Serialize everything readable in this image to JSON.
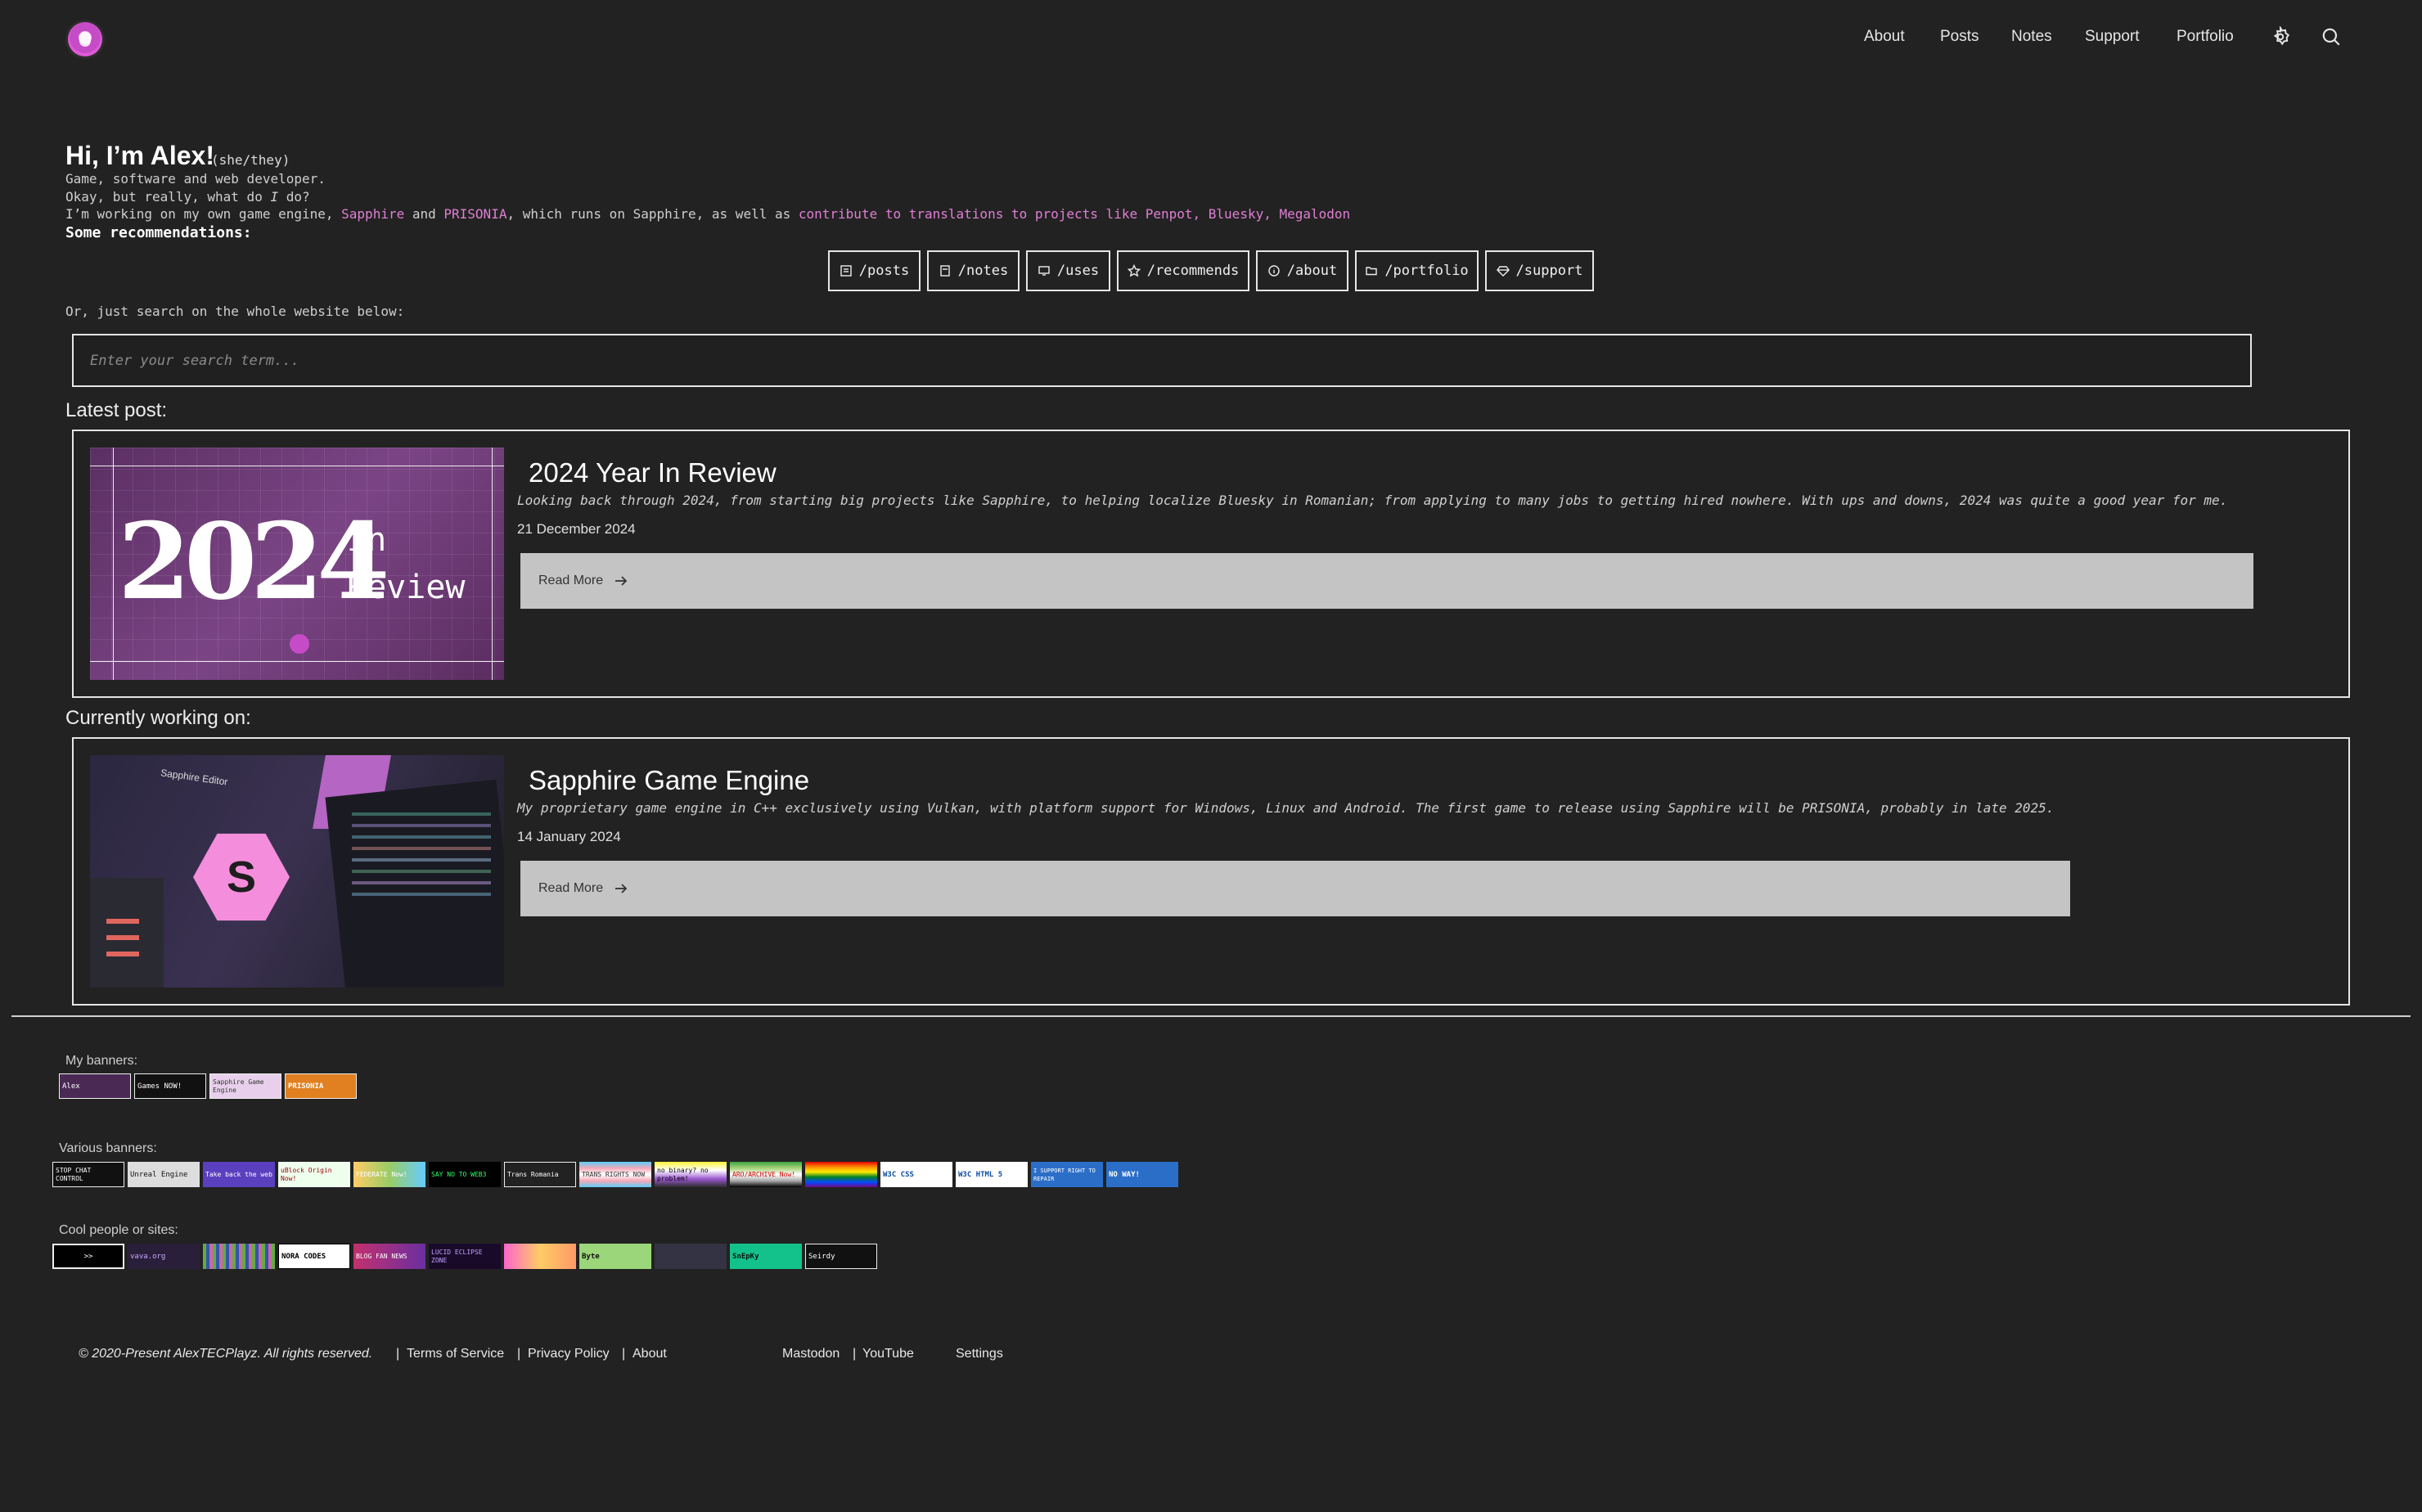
{
  "header": {
    "nav": [
      "About",
      "Posts",
      "Notes",
      "Support",
      "Portfolio"
    ]
  },
  "intro": {
    "greeting": "Hi, I’m Alex!",
    "pronouns": "(she/they)",
    "line1": "Game, software and web developer.",
    "line2a": "Okay, but really, what do ",
    "line2b": "I",
    "line2c": " do?",
    "line3_prefix": "I’m working on my own game engine, ",
    "link_sapphire": "Sapphire",
    "and": " and ",
    "link_prisonia": "PRISONIA",
    "line3_mid": ", which runs on Sapphire, as well as ",
    "link_translations": "contribute to translations to projects like Penpot, Bluesky, Megalodon",
    "recommendations_label": "Some recommendations:"
  },
  "chips": [
    "/posts",
    "/notes",
    "/uses",
    "/recommends",
    "/about",
    "/portfolio",
    "/support"
  ],
  "search": {
    "label": "Or, just search on the whole website below:",
    "placeholder": "Enter your search term..."
  },
  "latest": {
    "heading": "Latest post:",
    "title": "2024 Year In Review",
    "description": "Looking back through 2024, from starting big projects like Sapphire, to helping localize Bluesky in Romanian; from applying to many jobs to getting hired nowhere. With ups and downs, 2024 was quite a good year for me.",
    "date": "21 December 2024",
    "read_more": "Read More",
    "image_text_year": "2024",
    "image_text_in": "in",
    "image_text_review": "Review"
  },
  "working": {
    "heading": "Currently working on:",
    "title": "Sapphire Game Engine",
    "description": "My proprietary game engine in C++ exclusively using Vulkan, with platform support for Windows, Linux and Android. The first game to release using Sapphire will be PRISONIA, probably in late 2025.",
    "date": "14 January 2024",
    "read_more": "Read More",
    "image_caption": "Sapphire Editor",
    "image_letter": "S"
  },
  "banners": {
    "my_label": "My banners:",
    "my": [
      "Alex",
      "Games NOW!",
      "Sapphire Game Engine",
      "PRISONIA"
    ],
    "various_label": "Various banners:",
    "various": [
      "STOP CHAT CONTROL",
      "Unreal Engine",
      "Take back the web",
      "uBlock Origin Now!",
      "FEDERATE Now!",
      "SAY NO TO WEB3",
      "Trans Romania",
      "TRANS RIGHTS NOW",
      "no binary? no problem!",
      "ARO/ARCHIVE Now!",
      "",
      "W3C CSS",
      "W3C HTML 5",
      "I SUPPORT RIGHT TO REPAIR",
      "NO WAY!"
    ],
    "cool_label": "Cool people or sites:",
    "cool": [
      ">>",
      "vava.org",
      "",
      "NORA CODES",
      "BLOG FAN NEWS",
      "LUCID ECLIPSE ZONE",
      "",
      "Byte",
      "",
      "SnEpKy",
      "Seirdy"
    ]
  },
  "footer": {
    "copyright": "© 2020-Present AlexTECPlayz. All rights reserved.",
    "terms": "Terms of Service",
    "privacy": "Privacy Policy",
    "about": "About",
    "mastodon": "Mastodon",
    "youtube": "YouTube",
    "settings": "Settings",
    "sep": "|"
  },
  "colors": {
    "background": "#222222",
    "accent_link": "#e07fd4",
    "button_fill": "#c4c4c4"
  }
}
